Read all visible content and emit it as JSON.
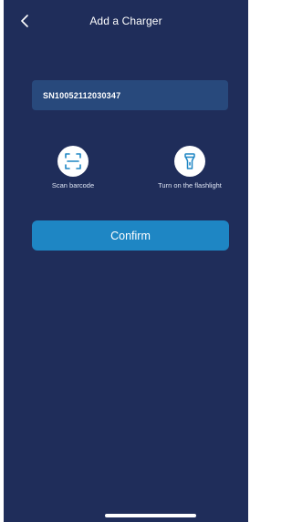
{
  "header": {
    "title": "Add a Charger",
    "back_icon": "chevron-left-icon"
  },
  "serial_input": {
    "value": "SN10052112030347"
  },
  "tools": {
    "scan": {
      "label": "Scan barcode",
      "icon": "barcode-scan-icon"
    },
    "flashlight": {
      "label": "Turn on the flashlight",
      "icon": "flashlight-icon"
    }
  },
  "confirm_button": {
    "label": "Confirm"
  },
  "colors": {
    "background": "#1f2d5a",
    "input_background": "#28497c",
    "accent": "#1e86c4",
    "icon_color": "#1e86c4"
  }
}
